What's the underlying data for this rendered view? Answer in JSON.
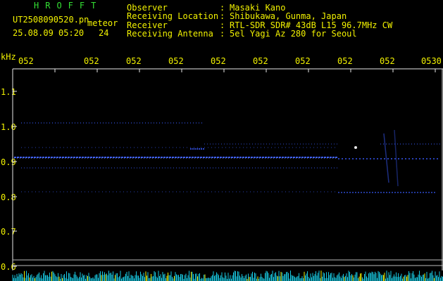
{
  "header": {
    "brand": "HROFFT",
    "filename": "UT2508090520.pn",
    "mode": "meteor",
    "datetime": "25.08.09 05:20",
    "count": "24"
  },
  "info": [
    {
      "key": "Observer",
      "value": "Masaki Kano"
    },
    {
      "key": "Receiving Location",
      "value": "Shibukawa, Gunma, Japan"
    },
    {
      "key": "Receiver",
      "value": "RTL-SDR SDR# 43dB L15 96.7MHz CW"
    },
    {
      "key": "Receiving Antenna",
      "value": "5el Yagi Az 280 for Seoul"
    }
  ],
  "axis": {
    "unit": "kHz",
    "time_ticks": [
      "052",
      "052",
      "052",
      "052",
      "052",
      "052",
      "052",
      "052",
      "052",
      "0530"
    ],
    "freq_ticks": [
      "1.1",
      "1.0",
      "0.9",
      "0.8",
      "0.7",
      "0.6"
    ]
  },
  "colors": {
    "text": "#f2f200",
    "brand": "#33e033",
    "signal": "#3a5cff",
    "signal_bright": "#8fa8ff",
    "spectrum": "#19c8e0",
    "background": "#000000"
  }
}
